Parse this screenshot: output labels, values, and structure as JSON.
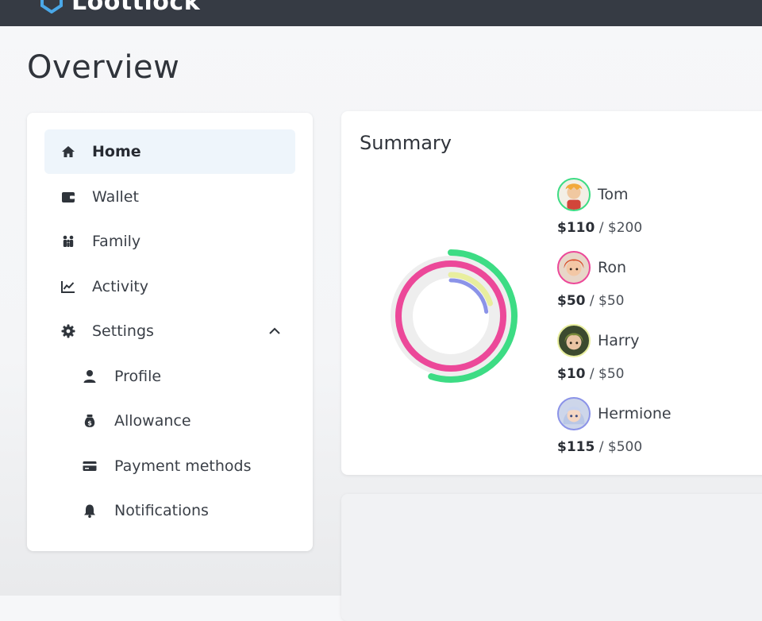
{
  "app": {
    "name": "Loottlock"
  },
  "page": {
    "title": "Overview"
  },
  "sidebar": {
    "items": [
      {
        "label": "Home",
        "icon": "home-icon",
        "active": true
      },
      {
        "label": "Wallet",
        "icon": "wallet-icon"
      },
      {
        "label": "Family",
        "icon": "family-icon"
      },
      {
        "label": "Activity",
        "icon": "activity-chart-icon"
      },
      {
        "label": "Settings",
        "icon": "gear-icon",
        "expanded": true
      }
    ],
    "settings_children": [
      {
        "label": "Profile",
        "icon": "person-icon"
      },
      {
        "label": "Allowance",
        "icon": "money-bag-icon"
      },
      {
        "label": "Payment methods",
        "icon": "credit-card-icon"
      },
      {
        "label": "Notifications",
        "icon": "bell-icon"
      }
    ]
  },
  "summary": {
    "title": "Summary",
    "people": [
      {
        "name": "Tom",
        "spent": "$110",
        "total": "$200",
        "fraction": 0.55,
        "color": "#3ddc84"
      },
      {
        "name": "Ron",
        "spent": "$50",
        "total": "$50",
        "fraction": 1.0,
        "color": "#ec4899"
      },
      {
        "name": "Harry",
        "spent": "$10",
        "total": "$50",
        "fraction": 0.2,
        "color": "#e8ee9e"
      },
      {
        "name": "Hermione",
        "spent": "$115",
        "total": "$500",
        "fraction": 0.23,
        "color": "#8b93e8"
      }
    ]
  },
  "colors": {
    "topbar": "#363b44",
    "active_bg": "#eef5fb",
    "ring_track": "#eeeeee"
  }
}
